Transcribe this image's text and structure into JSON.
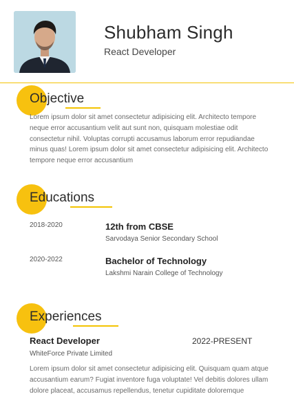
{
  "header": {
    "name": "Shubham Singh",
    "role": "React Developer"
  },
  "colors": {
    "accent": "#f7c10f",
    "divider": "#f3c300"
  },
  "objective": {
    "title": "Objective",
    "text": "Lorem ipsum dolor sit amet consectetur adipisicing elit. Architecto tempore neque error accusantium velit aut sunt non, quisquam molestiae odit consectetur nihil. Voluptas corrupti accusamus laborum error repudiandae minus quas! Lorem ipsum dolor sit amet consectetur adipisicing elit. Architecto tempore neque error accusantium"
  },
  "educations": {
    "title": "Educations",
    "items": [
      {
        "years": "2018-2020",
        "degree": "12th from CBSE",
        "school": "Sarvodaya Senior Secondary School"
      },
      {
        "years": "2020-2022",
        "degree": "Bachelor of Technology",
        "school": "Lakshmi Narain College of Technology"
      }
    ]
  },
  "experiences": {
    "title": "Experiences",
    "items": [
      {
        "role": "React Developer",
        "period": "2022-PRESENT",
        "company": "WhiteForce Private Limited",
        "text": "Lorem ipsum dolor sit amet consectetur adipisicing elit. Quisquam quam atque accusantium earum? Fugiat inventore fuga voluptate! Vel debitis dolores ullam dolore placeat, accusamus repellendus, tenetur cupiditate doloremque"
      }
    ]
  }
}
